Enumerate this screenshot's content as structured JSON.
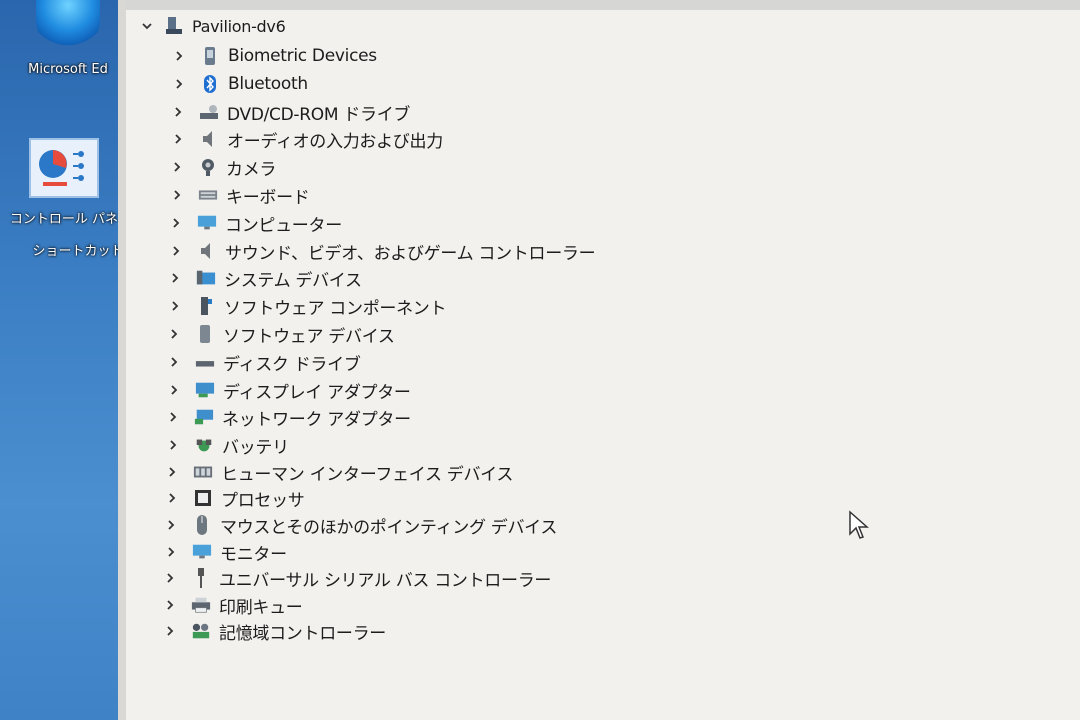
{
  "desktop": {
    "icons": [
      {
        "label": "Microsoft Ed",
        "icon": "edge-icon"
      },
      {
        "label_line1": "コントロール パネ",
        "label_line2": "ショートカット",
        "icon": "control-panel-icon"
      }
    ]
  },
  "device_manager": {
    "root": {
      "label": "Pavilion-dv6",
      "expanded": true,
      "icon": "computer-icon"
    },
    "categories": [
      {
        "label": "Biometric Devices",
        "icon": "biometric-icon"
      },
      {
        "label": "Bluetooth",
        "icon": "bluetooth-icon"
      },
      {
        "label": "DVD/CD-ROM ドライブ",
        "icon": "dvd-drive-icon"
      },
      {
        "label": "オーディオの入力および出力",
        "icon": "speaker-icon"
      },
      {
        "label": "カメラ",
        "icon": "camera-icon"
      },
      {
        "label": "キーボード",
        "icon": "keyboard-icon"
      },
      {
        "label": "コンピューター",
        "icon": "monitor-icon"
      },
      {
        "label": "サウンド、ビデオ、およびゲーム コントローラー",
        "icon": "speaker-icon"
      },
      {
        "label": "システム デバイス",
        "icon": "system-folder-icon"
      },
      {
        "label": "ソフトウェア コンポーネント",
        "icon": "software-component-icon"
      },
      {
        "label": "ソフトウェア デバイス",
        "icon": "software-device-icon"
      },
      {
        "label": "ディスク ドライブ",
        "icon": "disk-drive-icon"
      },
      {
        "label": "ディスプレイ アダプター",
        "icon": "display-adapter-icon"
      },
      {
        "label": "ネットワーク アダプター",
        "icon": "network-adapter-icon"
      },
      {
        "label": "バッテリ",
        "icon": "battery-icon"
      },
      {
        "label": "ヒューマン インターフェイス デバイス",
        "icon": "hid-icon"
      },
      {
        "label": "プロセッサ",
        "icon": "processor-icon"
      },
      {
        "label": "マウスとそのほかのポインティング デバイス",
        "icon": "mouse-icon"
      },
      {
        "label": "モニター",
        "icon": "monitor-icon"
      },
      {
        "label": "ユニバーサル シリアル バス コントローラー",
        "icon": "usb-icon"
      },
      {
        "label": "印刷キュー",
        "icon": "printer-icon"
      },
      {
        "label": "記憶域コントローラー",
        "icon": "storage-controller-icon"
      }
    ]
  }
}
